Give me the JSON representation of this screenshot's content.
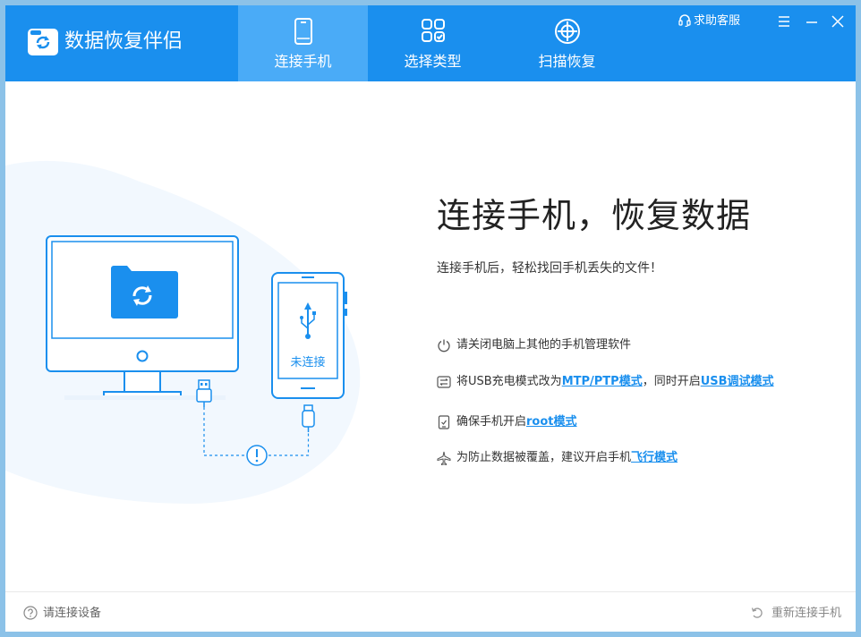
{
  "app": {
    "title": "数据恢复伴侣"
  },
  "tabs": [
    {
      "label": "连接手机",
      "icon": "phone-icon",
      "active": true
    },
    {
      "label": "选择类型",
      "icon": "grid-icon",
      "active": false
    },
    {
      "label": "扫描恢复",
      "icon": "crosshair-icon",
      "active": false
    }
  ],
  "header": {
    "help_label": "求助客服"
  },
  "illustration": {
    "phone_status": "未连接"
  },
  "main": {
    "headline": "连接手机，恢复数据",
    "subline": "连接手机后，轻松找回手机丢失的文件！",
    "tips": [
      {
        "icon": "power-icon",
        "text": "请关闭电脑上其他的手机管理软件"
      },
      {
        "icon": "usb-mode-icon",
        "pre": "将USB充电模式改为",
        "link1": "MTP/PTP模式",
        "mid": "，同时开启",
        "link2": "USB调试模式"
      },
      {
        "icon": "tablet-icon",
        "pre": "确保手机开启",
        "link1": "root模式"
      },
      {
        "icon": "airplane-icon",
        "pre": "为防止数据被覆盖，建议开启手机",
        "link1": "飞行模式"
      }
    ]
  },
  "footer": {
    "status": "请连接设备",
    "reconnect": "重新连接手机"
  },
  "colors": {
    "brand": "#1a8fee",
    "tab_active": "#4aabf7",
    "link": "#1a8fee"
  }
}
